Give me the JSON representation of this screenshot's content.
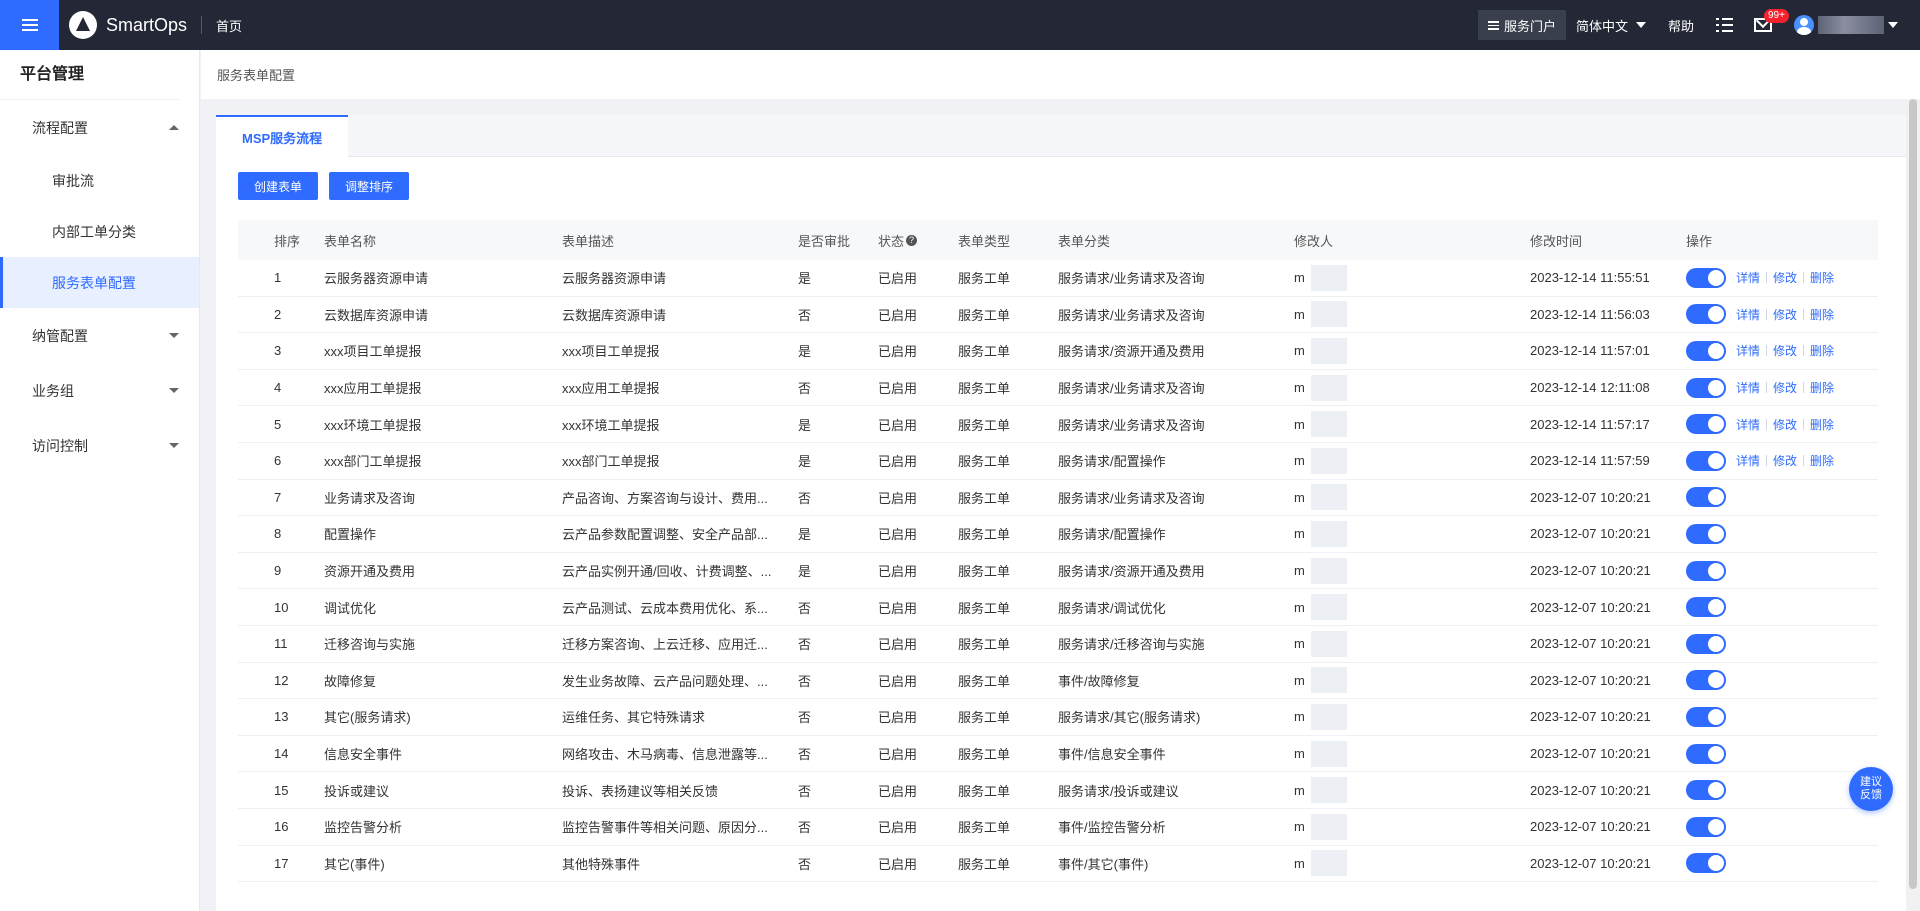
{
  "topbar": {
    "brand": "SmartOps",
    "home": "首页",
    "portal": "服务门户",
    "language": "简体中文",
    "help": "帮助",
    "badge": "99+"
  },
  "sidebar": {
    "title": "平台管理",
    "groups": [
      {
        "label": "流程配置",
        "expanded": true,
        "items": [
          "审批流",
          "内部工单分类",
          "服务表单配置"
        ]
      },
      {
        "label": "纳管配置",
        "expanded": false
      },
      {
        "label": "业务组",
        "expanded": false
      },
      {
        "label": "访问控制",
        "expanded": false
      }
    ],
    "active_item": "服务表单配置"
  },
  "breadcrumb": "服务表单配置",
  "tab": "MSP服务流程",
  "buttons": {
    "create": "创建表单",
    "sort": "调整排序"
  },
  "table": {
    "headers": [
      "排序",
      "表单名称",
      "表单描述",
      "是否审批",
      "状态",
      "表单类型",
      "表单分类",
      "修改人",
      "修改时间",
      "操作"
    ],
    "op_labels": {
      "detail": "详情",
      "edit": "修改",
      "delete": "删除"
    },
    "rows": [
      {
        "no": "1",
        "name": "云服务器资源申请",
        "desc": "云服务器资源申请",
        "approval": "是",
        "status": "已启用",
        "type": "服务工单",
        "category": "服务请求/业务请求及咨询",
        "modifier": "m",
        "time": "2023-12-14 11:55:51",
        "enabled": true,
        "ops": true
      },
      {
        "no": "2",
        "name": "云数据库资源申请",
        "desc": "云数据库资源申请",
        "approval": "否",
        "status": "已启用",
        "type": "服务工单",
        "category": "服务请求/业务请求及咨询",
        "modifier": "m",
        "time": "2023-12-14 11:56:03",
        "enabled": true,
        "ops": true
      },
      {
        "no": "3",
        "name": "xxx项目工单提报",
        "desc": "xxx项目工单提报",
        "approval": "是",
        "status": "已启用",
        "type": "服务工单",
        "category": "服务请求/资源开通及费用",
        "modifier": "m",
        "time": "2023-12-14 11:57:01",
        "enabled": true,
        "ops": true
      },
      {
        "no": "4",
        "name": "xxx应用工单提报",
        "desc": "xxx应用工单提报",
        "approval": "否",
        "status": "已启用",
        "type": "服务工单",
        "category": "服务请求/业务请求及咨询",
        "modifier": "m",
        "time": "2023-12-14 12:11:08",
        "enabled": true,
        "ops": true
      },
      {
        "no": "5",
        "name": "xxx环境工单提报",
        "desc": "xxx环境工单提报",
        "approval": "是",
        "status": "已启用",
        "type": "服务工单",
        "category": "服务请求/业务请求及咨询",
        "modifier": "m",
        "time": "2023-12-14 11:57:17",
        "enabled": true,
        "ops": true
      },
      {
        "no": "6",
        "name": "xxx部门工单提报",
        "desc": "xxx部门工单提报",
        "approval": "是",
        "status": "已启用",
        "type": "服务工单",
        "category": "服务请求/配置操作",
        "modifier": "m",
        "time": "2023-12-14 11:57:59",
        "enabled": true,
        "ops": true
      },
      {
        "no": "7",
        "name": "业务请求及咨询",
        "desc": "产品咨询、方案咨询与设计、费用...",
        "approval": "否",
        "status": "已启用",
        "type": "服务工单",
        "category": "服务请求/业务请求及咨询",
        "modifier": "m",
        "time": "2023-12-07 10:20:21",
        "enabled": true,
        "ops": false
      },
      {
        "no": "8",
        "name": "配置操作",
        "desc": "云产品参数配置调整、安全产品部...",
        "approval": "是",
        "status": "已启用",
        "type": "服务工单",
        "category": "服务请求/配置操作",
        "modifier": "m",
        "time": "2023-12-07 10:20:21",
        "enabled": true,
        "ops": false
      },
      {
        "no": "9",
        "name": "资源开通及费用",
        "desc": "云产品实例开通/回收、计费调整、...",
        "approval": "是",
        "status": "已启用",
        "type": "服务工单",
        "category": "服务请求/资源开通及费用",
        "modifier": "m",
        "time": "2023-12-07 10:20:21",
        "enabled": true,
        "ops": false
      },
      {
        "no": "10",
        "name": "调试优化",
        "desc": "云产品测试、云成本费用优化、系...",
        "approval": "否",
        "status": "已启用",
        "type": "服务工单",
        "category": "服务请求/调试优化",
        "modifier": "m",
        "time": "2023-12-07 10:20:21",
        "enabled": true,
        "ops": false
      },
      {
        "no": "11",
        "name": "迁移咨询与实施",
        "desc": "迁移方案咨询、上云迁移、应用迁...",
        "approval": "否",
        "status": "已启用",
        "type": "服务工单",
        "category": "服务请求/迁移咨询与实施",
        "modifier": "m",
        "time": "2023-12-07 10:20:21",
        "enabled": true,
        "ops": false
      },
      {
        "no": "12",
        "name": "故障修复",
        "desc": "发生业务故障、云产品问题处理、...",
        "approval": "否",
        "status": "已启用",
        "type": "服务工单",
        "category": "事件/故障修复",
        "modifier": "m",
        "time": "2023-12-07 10:20:21",
        "enabled": true,
        "ops": false
      },
      {
        "no": "13",
        "name": "其它(服务请求)",
        "desc": "运维任务、其它特殊请求",
        "approval": "否",
        "status": "已启用",
        "type": "服务工单",
        "category": "服务请求/其它(服务请求)",
        "modifier": "m",
        "time": "2023-12-07 10:20:21",
        "enabled": true,
        "ops": false
      },
      {
        "no": "14",
        "name": "信息安全事件",
        "desc": "网络攻击、木马病毒、信息泄露等...",
        "approval": "否",
        "status": "已启用",
        "type": "服务工单",
        "category": "事件/信息安全事件",
        "modifier": "m",
        "time": "2023-12-07 10:20:21",
        "enabled": true,
        "ops": false
      },
      {
        "no": "15",
        "name": "投诉或建议",
        "desc": "投诉、表扬建议等相关反馈",
        "approval": "否",
        "status": "已启用",
        "type": "服务工单",
        "category": "服务请求/投诉或建议",
        "modifier": "m",
        "time": "2023-12-07 10:20:21",
        "enabled": true,
        "ops": false
      },
      {
        "no": "16",
        "name": "监控告警分析",
        "desc": "监控告警事件等相关问题、原因分...",
        "approval": "否",
        "status": "已启用",
        "type": "服务工单",
        "category": "事件/监控告警分析",
        "modifier": "m",
        "time": "2023-12-07 10:20:21",
        "enabled": true,
        "ops": false
      },
      {
        "no": "17",
        "name": "其它(事件)",
        "desc": "其他特殊事件",
        "approval": "否",
        "status": "已启用",
        "type": "服务工单",
        "category": "事件/其它(事件)",
        "modifier": "m",
        "time": "2023-12-07 10:20:21",
        "enabled": true,
        "ops": false
      }
    ]
  },
  "feedback": {
    "line1": "建议",
    "line2": "反馈"
  }
}
